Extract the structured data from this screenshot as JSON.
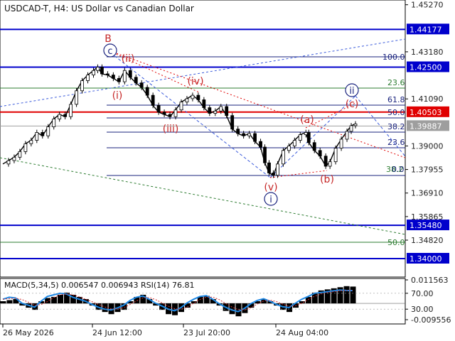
{
  "header": {
    "symbol_line": "USDCAD-T, H4:  US Dollar vs Canadian Dollar"
  },
  "colors": {
    "candle": "#000000",
    "level_blue": "#0000cc",
    "level_red": "#e00000",
    "fib_green": "#2e7d32",
    "fib_navy": "#1a237e",
    "fib_blue_dashed": "#3b5bdb",
    "wave_red": "#c62828",
    "macd_hist": "#000000",
    "rsi_line": "#1e88e5",
    "signal_red": "#d32f2f"
  },
  "chart_data": [
    {
      "type": "line",
      "title": "USDCAD-T, H4:  US Dollar vs Canadian Dollar",
      "x_ticks": [
        "26 May 2026",
        "24 Jun 12:00",
        "23 Jul 20:00",
        "24 Aug 04:00"
      ],
      "y_ticks": [
        "1.45270",
        "1.43180",
        "1.41090",
        "1.39000",
        "1.37955",
        "1.36910",
        "1.35865",
        "1.34820"
      ],
      "ylim": [
        1.3318,
        1.4548
      ],
      "price_path": [
        [
          0,
          1.382
        ],
        [
          8,
          1.3835
        ],
        [
          16,
          1.385
        ],
        [
          24,
          1.3875
        ],
        [
          32,
          1.391
        ],
        [
          40,
          1.3925
        ],
        [
          48,
          1.396
        ],
        [
          56,
          1.3945
        ],
        [
          64,
          1.3985
        ],
        [
          72,
          1.402
        ],
        [
          80,
          1.404
        ],
        [
          88,
          1.403
        ],
        [
          96,
          1.4085
        ],
        [
          104,
          1.4145
        ],
        [
          112,
          1.419
        ],
        [
          120,
          1.4215
        ],
        [
          128,
          1.4235
        ],
        [
          134,
          1.425
        ],
        [
          140,
          1.422
        ],
        [
          148,
          1.4215
        ],
        [
          156,
          1.42
        ],
        [
          164,
          1.4185
        ],
        [
          172,
          1.4235
        ],
        [
          180,
          1.4205
        ],
        [
          188,
          1.418
        ],
        [
          196,
          1.416
        ],
        [
          204,
          1.4125
        ],
        [
          212,
          1.408
        ],
        [
          220,
          1.405
        ],
        [
          228,
          1.404
        ],
        [
          236,
          1.403
        ],
        [
          244,
          1.406
        ],
        [
          252,
          1.4095
        ],
        [
          260,
          1.411
        ],
        [
          268,
          1.4125
        ],
        [
          276,
          1.4105
        ],
        [
          284,
          1.407
        ],
        [
          292,
          1.4045
        ],
        [
          300,
          1.4055
        ],
        [
          308,
          1.4075
        ],
        [
          316,
          1.4035
        ],
        [
          324,
          1.3975
        ],
        [
          332,
          1.3955
        ],
        [
          340,
          1.3945
        ],
        [
          348,
          1.3955
        ],
        [
          356,
          1.392
        ],
        [
          364,
          1.3895
        ],
        [
          370,
          1.3825
        ],
        [
          376,
          1.378
        ],
        [
          382,
          1.377
        ],
        [
          388,
          1.382
        ],
        [
          396,
          1.388
        ],
        [
          404,
          1.39
        ],
        [
          412,
          1.3925
        ],
        [
          420,
          1.395
        ],
        [
          428,
          1.396
        ],
        [
          432,
          1.3915
        ],
        [
          440,
          1.388
        ],
        [
          448,
          1.3855
        ],
        [
          456,
          1.381
        ],
        [
          462,
          1.383
        ],
        [
          470,
          1.389
        ],
        [
          478,
          1.393
        ],
        [
          486,
          1.3965
        ],
        [
          492,
          1.399
        ],
        [
          498,
          1.3998
        ]
      ],
      "levels": [
        {
          "price": "1.44177",
          "value": 1.44177,
          "color": "#0000cc",
          "style": "solid"
        },
        {
          "price": "1.42500",
          "value": 1.425,
          "color": "#0000cc",
          "style": "solid"
        },
        {
          "price": "1.40503",
          "value": 1.40503,
          "color": "#e00000",
          "style": "solid"
        },
        {
          "price": "1.39887",
          "value": 1.39887,
          "color": "#9e9e9e",
          "style": "solid"
        },
        {
          "price": "1.35480",
          "value": 1.3548,
          "color": "#0000cc",
          "style": "solid"
        },
        {
          "price": "1.34000",
          "value": 1.34,
          "color": "#0000cc",
          "style": "solid"
        }
      ],
      "fib_levels": [
        {
          "label": "100.0",
          "color": "#1a237e"
        },
        {
          "label": "23.6",
          "color": "#2e7d32"
        },
        {
          "label": "61.8",
          "color": "#1a237e"
        },
        {
          "label": "50.0",
          "color": "#1a237e"
        },
        {
          "label": "38.2",
          "color": "#1a237e"
        },
        {
          "label": "23.6",
          "color": "#1a237e"
        },
        {
          "label": "38.2",
          "color": "#2e7d32"
        },
        {
          "label": "0.0",
          "color": "#1a237e"
        },
        {
          "label": "50.0",
          "color": "#2e7d32"
        }
      ],
      "wave_labels": [
        {
          "text": "B",
          "circled": false
        },
        {
          "text": "c",
          "circled": true
        },
        {
          "text": "(ii)",
          "circled": false
        },
        {
          "text": "(i)",
          "circled": false
        },
        {
          "text": "(iv)",
          "circled": false
        },
        {
          "text": "(iii)",
          "circled": false
        },
        {
          "text": "(a)",
          "circled": false
        },
        {
          "text": "(c)",
          "circled": false
        },
        {
          "text": "(b)",
          "circled": false
        },
        {
          "text": "(v)",
          "circled": false
        },
        {
          "text": "i",
          "circled": true
        },
        {
          "text": "ii",
          "circled": true
        }
      ]
    },
    {
      "type": "area",
      "title": "MACD(5,34,5) 0.006547 0.006943 RSI(14) 76.81",
      "y_ticks": [
        "0.011563",
        "70.00",
        "30.00",
        "-0.009556"
      ],
      "ylim": [
        -0.009556,
        0.011563
      ],
      "histogram": [
        0.001,
        0.0015,
        0.002,
        -0.001,
        -0.002,
        -0.003,
        0.001,
        0.0025,
        0.003,
        0.004,
        0.005,
        0.004,
        0.003,
        0.002,
        -0.001,
        -0.003,
        -0.004,
        -0.005,
        -0.004,
        -0.003,
        0.001,
        0.003,
        0.004,
        0.002,
        -0.001,
        -0.003,
        -0.005,
        -0.0055,
        -0.004,
        -0.002,
        0.001,
        0.003,
        0.0035,
        0.002,
        -0.001,
        -0.0035,
        -0.005,
        -0.006,
        -0.0045,
        -0.002,
        0.001,
        0.002,
        0.001,
        -0.001,
        -0.003,
        -0.004,
        -0.002,
        0.001,
        0.003,
        0.005,
        0.006,
        0.0065,
        0.007,
        0.0075,
        0.008,
        0.0078
      ],
      "rsi": [
        55,
        60,
        58,
        45,
        40,
        35,
        50,
        62,
        66,
        70,
        68,
        60,
        55,
        50,
        42,
        35,
        30,
        28,
        33,
        40,
        52,
        60,
        63,
        55,
        45,
        38,
        30,
        26,
        34,
        46,
        55,
        62,
        64,
        55,
        44,
        35,
        28,
        24,
        32,
        44,
        52,
        56,
        50,
        42,
        36,
        34,
        45,
        55,
        62,
        70,
        72,
        74,
        76,
        78,
        77,
        76.81
      ]
    }
  ]
}
